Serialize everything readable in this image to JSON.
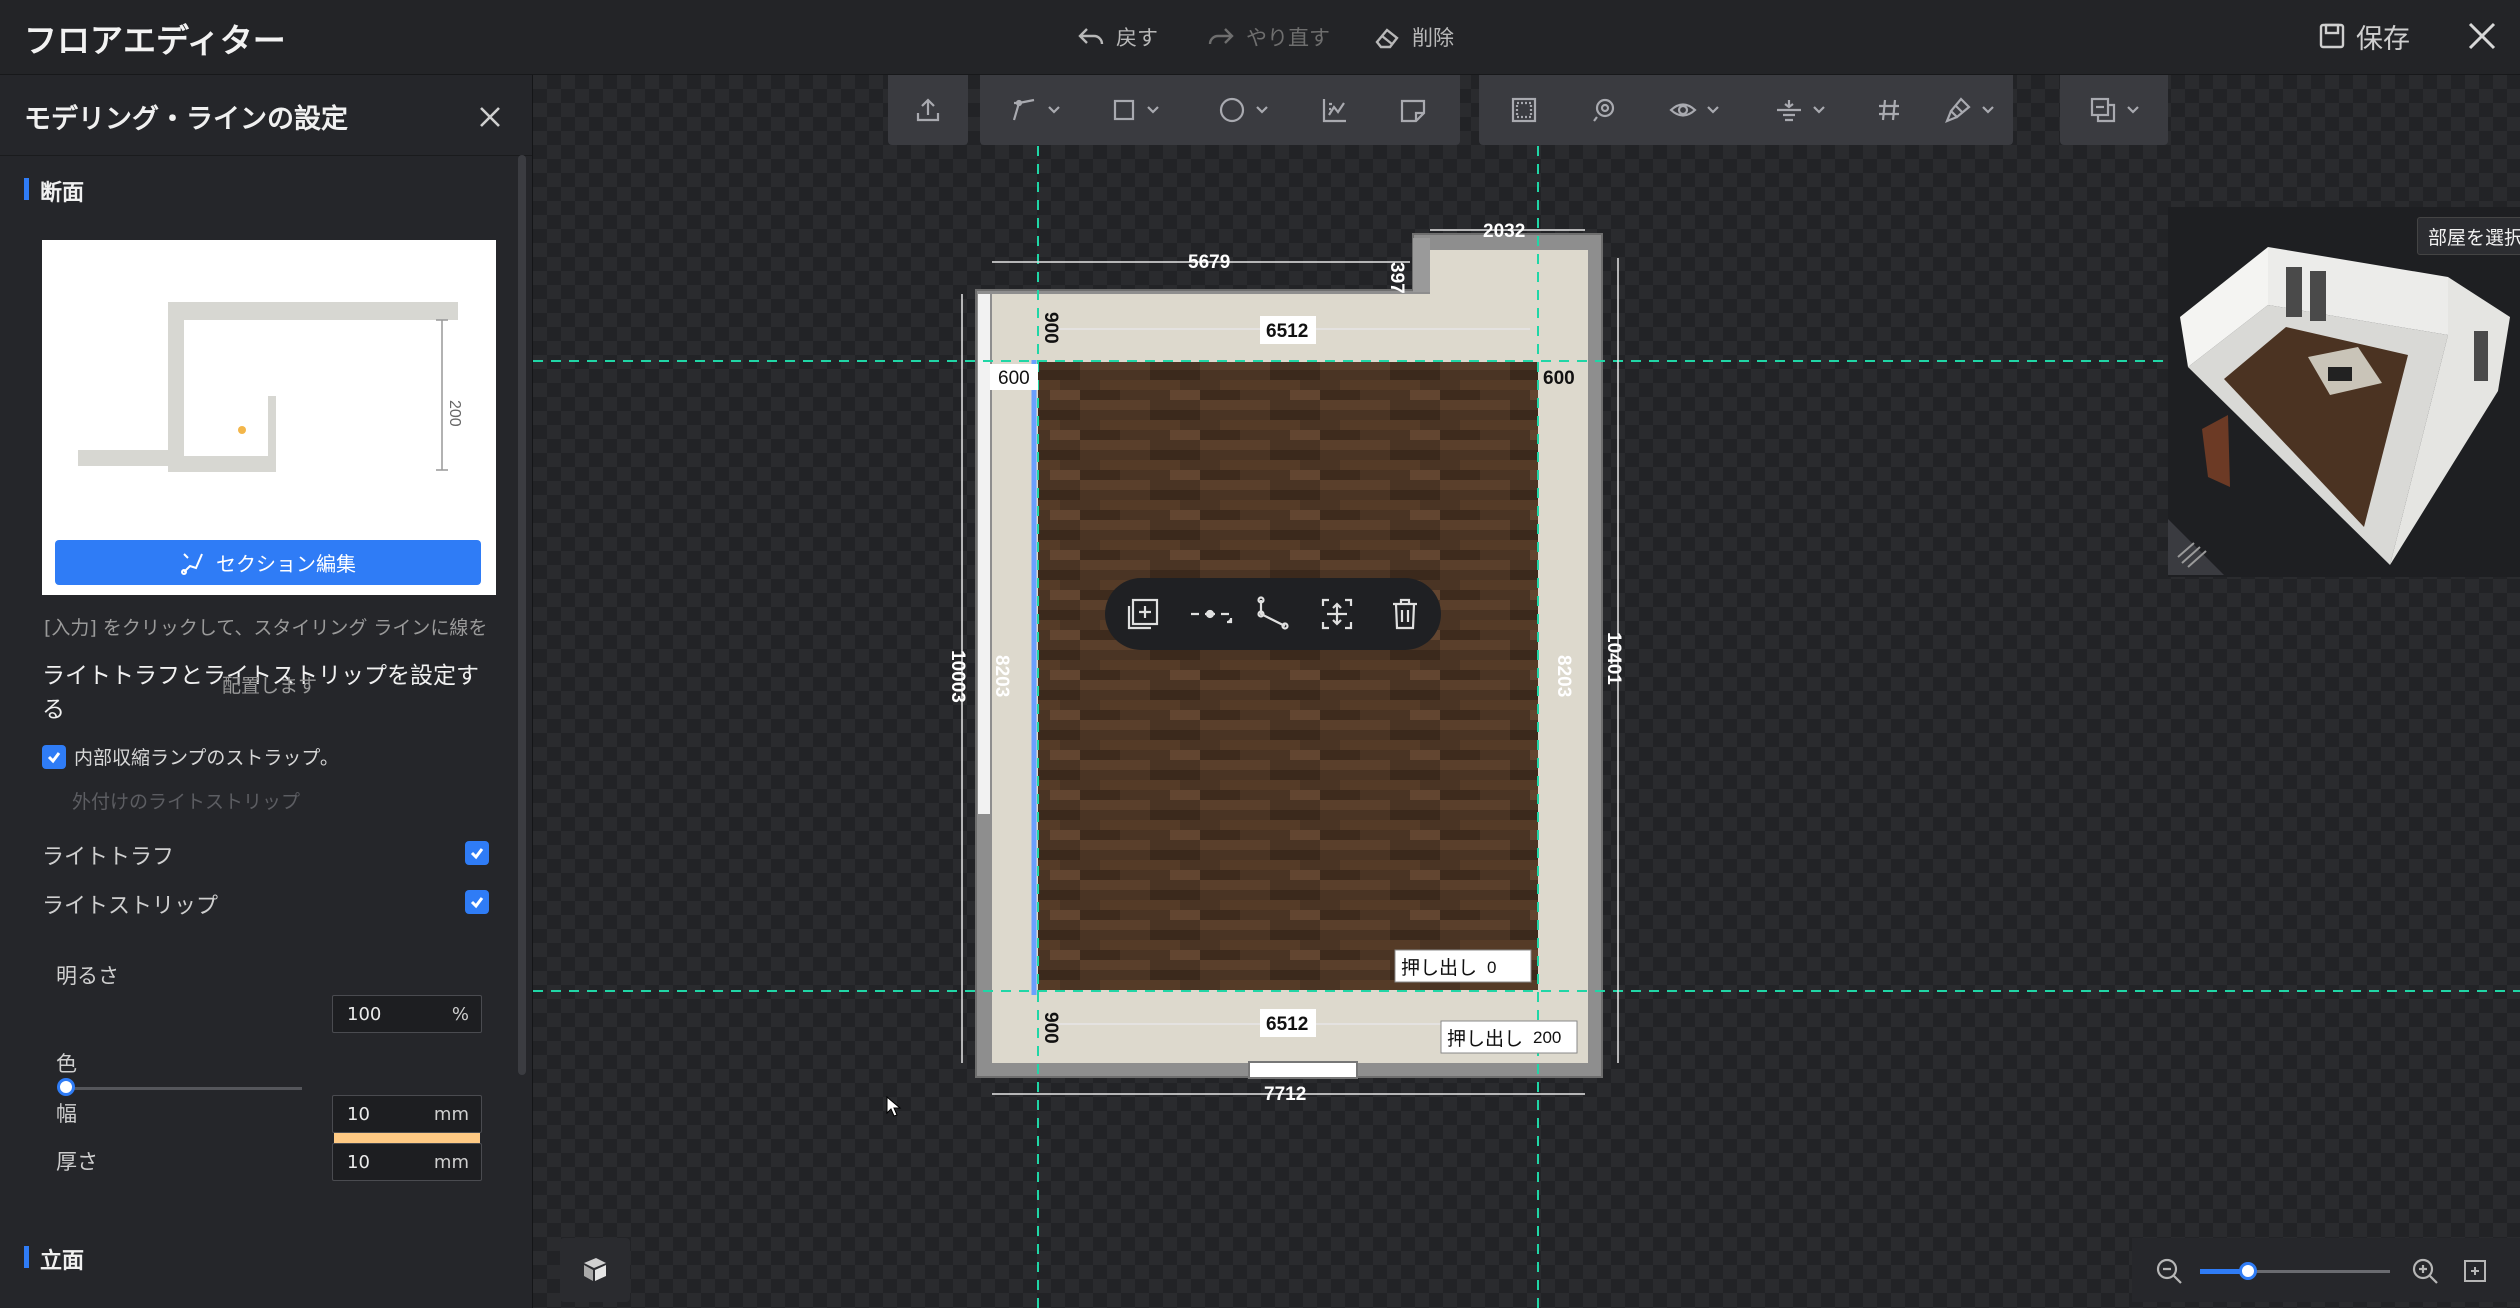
{
  "app": {
    "title": "フロアエディター",
    "undo_label": "戻す",
    "redo_label": "やり直す",
    "delete_label": "削除",
    "save_label": "保存"
  },
  "panel": {
    "title": "モデリング・ラインの設定",
    "section_label": "断面",
    "preview_dimension": "200",
    "section_edit_label": "セクション編集",
    "hint_text": "[入力] をクリックして、スタイリング ラインに線を",
    "hint_overlap_text": "配置します",
    "trough_title": "ライトトラフとライトストリップを設定する",
    "internal_strap_label": "内部収縮ランプのストラップ。",
    "internal_strap_checked": true,
    "external_strip_label": "外付けのライトストリップ",
    "light_trough_label": "ライトトラフ",
    "light_trough_checked": true,
    "light_strip_label": "ライトストリップ",
    "light_strip_checked": true,
    "brightness_label": "明るさ",
    "brightness_value": "100",
    "brightness_unit": "%",
    "brightness_level": 0,
    "color_label": "色",
    "color_value": "#ffca84",
    "width_label": "幅",
    "width_value": "10",
    "width_unit": "mm",
    "thickness_label": "厚さ",
    "thickness_value": "10",
    "thickness_unit": "mm",
    "elevation_label": "立面"
  },
  "floorplan": {
    "dim_top_left": "5679",
    "dim_top_right": "2032",
    "dim_notch": "397",
    "dim_inner_top": "6512",
    "dim_inner_bottom": "6512",
    "dim_bottom": "7712",
    "dim_left_outer": "10003",
    "dim_right_outer": "10401",
    "dim_left_inner": "8203",
    "dim_right_inner": "8203",
    "dim_top_offset": "900",
    "dim_bottom_offset": "900",
    "margin_left": "600",
    "margin_right": "600",
    "extrude_label_1": "押し出し",
    "extrude_value_1": "0",
    "extrude_label_2": "押し出し",
    "extrude_value_2": "200"
  },
  "preview": {
    "select_room_label": "部屋を選択"
  },
  "zoom": {
    "level": 0.25
  },
  "colors": {
    "accent": "#2f7cf6",
    "guide": "#20d6a6",
    "light": "#ffca84"
  }
}
